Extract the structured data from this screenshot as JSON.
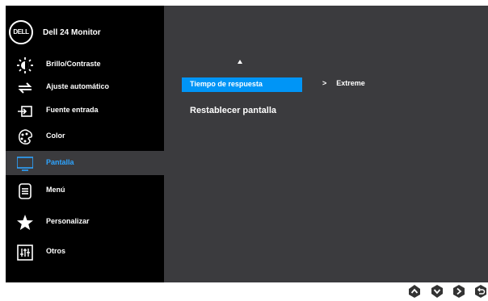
{
  "brand": {
    "logo": "DELL",
    "model": "Dell 24 Monitor"
  },
  "menu": [
    {
      "key": "brightness",
      "label": "Brillo/Contraste",
      "icon": "brightness-icon"
    },
    {
      "key": "auto-adjust",
      "label": "Ajuste automático",
      "icon": "auto-adjust-icon"
    },
    {
      "key": "input-source",
      "label": "Fuente entrada",
      "icon": "input-source-icon"
    },
    {
      "key": "color",
      "label": "Color",
      "icon": "palette-icon"
    },
    {
      "key": "display",
      "label": "Pantalla",
      "icon": "display-icon",
      "active": true
    },
    {
      "key": "menu",
      "label": "Menú",
      "icon": "menu-icon"
    },
    {
      "key": "personalize",
      "label": "Personalizar",
      "icon": "star-icon"
    },
    {
      "key": "others",
      "label": "Otros",
      "icon": "others-icon"
    }
  ],
  "display_panel": {
    "items": [
      {
        "label": "Tiempo de respuesta",
        "selected": true,
        "value_sep": ">",
        "value": "Extreme"
      },
      {
        "label": "Restablecer pantalla",
        "selected": false
      }
    ]
  },
  "nav_buttons": [
    {
      "name": "up-button",
      "icon": "up-icon"
    },
    {
      "name": "down-button",
      "icon": "down-icon"
    },
    {
      "name": "next-button",
      "icon": "right-icon"
    },
    {
      "name": "back-button",
      "icon": "back-icon"
    }
  ],
  "colors": {
    "panel": "#3b3b3e",
    "sidebar": "#000000",
    "accent": "#0095f6",
    "active_label": "#2ea4ff"
  }
}
